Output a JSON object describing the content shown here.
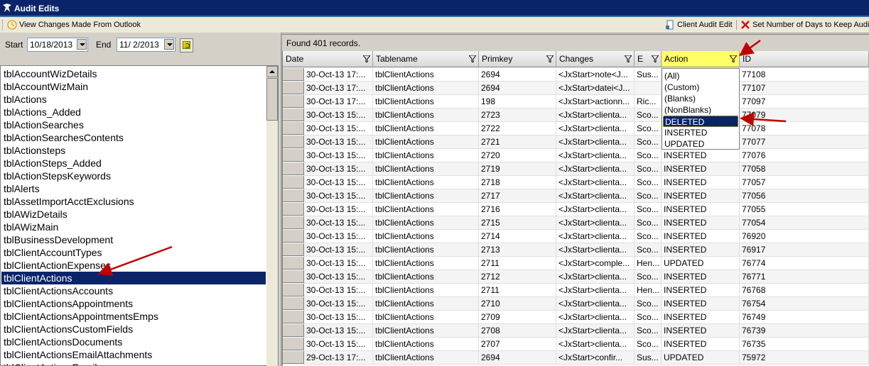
{
  "window": {
    "title": "Audit Edits"
  },
  "toolbar": {
    "view_changes": "View Changes Made From Outlook",
    "client_audit_edit": "Client Audit Edit",
    "set_days": "Set Number of Days to Keep Audit"
  },
  "filters": {
    "start_label": "Start",
    "start_value": "10/18/2013",
    "end_label": "End",
    "end_value": "11/ 2/2013"
  },
  "tables": {
    "items": [
      "tblAccountWizDetails",
      "tblAccountWizMain",
      "tblActions",
      "tblActions_Added",
      "tblActionSearches",
      "tblActionSearchesContents",
      "tblActionsteps",
      "tblActionSteps_Added",
      "tblActionStepsKeywords",
      "tblAlerts",
      "tblAssetImportAcctExclusions",
      "tblAWizDetails",
      "tblAWizMain",
      "tblBusinessDevelopment",
      "tblClientAccountTypes",
      "tblClientActionExpenses",
      "tblClientActions",
      "tblClientActionsAccounts",
      "tblClientActionsAppointments",
      "tblClientActionsAppointmentsEmps",
      "tblClientActionsCustomFields",
      "tblClientActionsDocuments",
      "tblClientActionsEmailAttachments",
      "tblClientActionsEmails"
    ],
    "selected": "tblClientActions"
  },
  "grid": {
    "found_text": "Found 401 records.",
    "columns": [
      "Date",
      "Tablename",
      "Primkey",
      "Changes",
      "E",
      "Action",
      "ID"
    ],
    "rows": [
      [
        "30-Oct-13  17:...",
        "tblClientActions",
        "2694",
        "<JxStart>note<J...",
        "Sus...",
        "",
        "77108"
      ],
      [
        "30-Oct-13  17:...",
        "tblClientActions",
        "2694",
        "<JxStart>datei<J...",
        "",
        "",
        "77107"
      ],
      [
        "30-Oct-13  17:...",
        "tblClientActions",
        "198",
        "<JxStart>actionn...",
        "Ric...",
        "",
        "77097"
      ],
      [
        "30-Oct-13  15:...",
        "tblClientActions",
        "2723",
        "<JxStart>clienta...",
        "Sco...",
        "",
        "77079"
      ],
      [
        "30-Oct-13  15:...",
        "tblClientActions",
        "2722",
        "<JxStart>clienta...",
        "Sco...",
        "",
        "77078"
      ],
      [
        "30-Oct-13  15:...",
        "tblClientActions",
        "2721",
        "<JxStart>clienta...",
        "Sco...",
        "",
        "77077"
      ],
      [
        "30-Oct-13  15:...",
        "tblClientActions",
        "2720",
        "<JxStart>clienta...",
        "Sco...",
        "INSERTED",
        "77076"
      ],
      [
        "30-Oct-13  15:...",
        "tblClientActions",
        "2719",
        "<JxStart>clienta...",
        "Sco...",
        "INSERTED",
        "77058"
      ],
      [
        "30-Oct-13  15:...",
        "tblClientActions",
        "2718",
        "<JxStart>clienta...",
        "Sco...",
        "INSERTED",
        "77057"
      ],
      [
        "30-Oct-13  15:...",
        "tblClientActions",
        "2717",
        "<JxStart>clienta...",
        "Sco...",
        "INSERTED",
        "77056"
      ],
      [
        "30-Oct-13  15:...",
        "tblClientActions",
        "2716",
        "<JxStart>clienta...",
        "Sco...",
        "INSERTED",
        "77055"
      ],
      [
        "30-Oct-13  15:...",
        "tblClientActions",
        "2715",
        "<JxStart>clienta...",
        "Sco...",
        "INSERTED",
        "77054"
      ],
      [
        "30-Oct-13  15:...",
        "tblClientActions",
        "2714",
        "<JxStart>clienta...",
        "Sco...",
        "INSERTED",
        "76920"
      ],
      [
        "30-Oct-13  15:...",
        "tblClientActions",
        "2713",
        "<JxStart>clienta...",
        "Sco...",
        "INSERTED",
        "76917"
      ],
      [
        "30-Oct-13  15:...",
        "tblClientActions",
        "2711",
        "<JxStart>comple...",
        "Hen...",
        "UPDATED",
        "76774"
      ],
      [
        "30-Oct-13  15:...",
        "tblClientActions",
        "2712",
        "<JxStart>clienta...",
        "Sco...",
        "INSERTED",
        "76771"
      ],
      [
        "30-Oct-13  15:...",
        "tblClientActions",
        "2711",
        "<JxStart>clienta...",
        "Hen...",
        "INSERTED",
        "76768"
      ],
      [
        "30-Oct-13  15:...",
        "tblClientActions",
        "2710",
        "<JxStart>clienta...",
        "Sco...",
        "INSERTED",
        "76754"
      ],
      [
        "30-Oct-13  15:...",
        "tblClientActions",
        "2709",
        "<JxStart>clienta...",
        "Sco...",
        "INSERTED",
        "76749"
      ],
      [
        "30-Oct-13  15:...",
        "tblClientActions",
        "2708",
        "<JxStart>clienta...",
        "Sco...",
        "INSERTED",
        "76739"
      ],
      [
        "30-Oct-13  15:...",
        "tblClientActions",
        "2707",
        "<JxStart>clienta...",
        "Sco...",
        "INSERTED",
        "76735"
      ],
      [
        "29-Oct-13  17:...",
        "tblClientActions",
        "2694",
        "<JxStart>confir...",
        "Sus...",
        "UPDATED",
        "75972"
      ]
    ]
  },
  "action_filter": {
    "options": [
      "(All)",
      "(Custom)",
      "(Blanks)",
      "(NonBlanks)",
      "DELETED",
      "INSERTED",
      "UPDATED"
    ],
    "selected": "DELETED"
  },
  "colors": {
    "title": "#0a246a",
    "selection": "#0a246a",
    "active_header": "#ffff66",
    "arrow": "#c00000"
  }
}
